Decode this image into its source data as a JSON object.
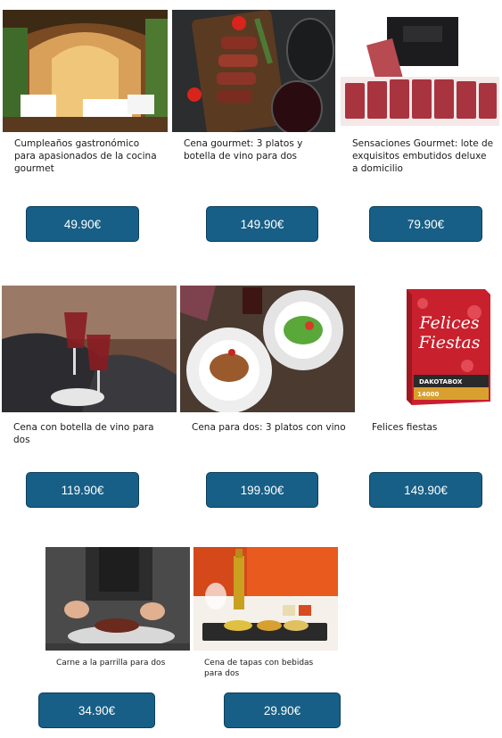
{
  "products": [
    {
      "title": "Cumpleaños gastronómico para apasionados de la cocina gourmet",
      "price": "49.90€",
      "image": "restaurant-interior"
    },
    {
      "title": "Cena gourmet: 3 platos y botella de vino para dos",
      "price": "149.90€",
      "image": "steak-wine"
    },
    {
      "title": "Sensaciones Gourmet: lote de exquisitos embutidos deluxe a domicilio",
      "price": "79.90€",
      "image": "cured-meats-box"
    },
    {
      "title": "Cena con botella de vino para dos",
      "price": "119.90€",
      "image": "wine-toast"
    },
    {
      "title": "Cena para dos: 3 platos con vino",
      "price": "199.90€",
      "image": "plates-salad"
    },
    {
      "title": "Felices fiestas",
      "price": "149.90€",
      "image": "gift-box",
      "box_text": {
        "line1": "Felices",
        "line2": "Fiestas",
        "brand": "DAKOTABOX",
        "count": "14000"
      }
    },
    {
      "title": "Carne a la parrilla para dos",
      "price": "34.90€",
      "image": "chef-plating"
    },
    {
      "title": "Cena de tapas con bebidas para dos",
      "price": "29.90€",
      "image": "tapas-beer"
    }
  ],
  "colors": {
    "button": "#175f86",
    "button_border": "#0d3f5c",
    "box_red": "#c8202d"
  }
}
